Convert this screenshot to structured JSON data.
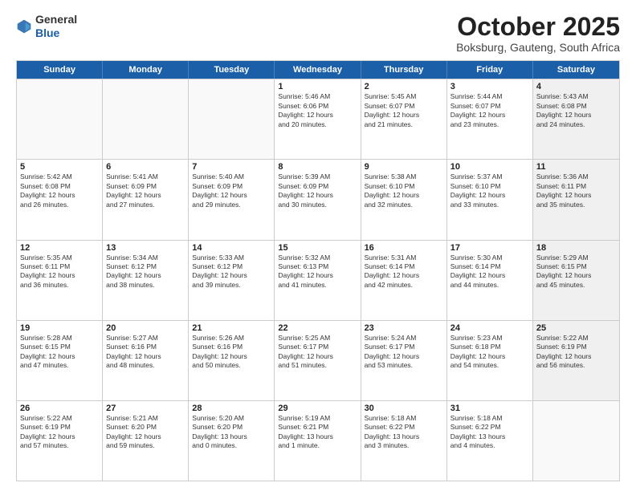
{
  "header": {
    "logo_general": "General",
    "logo_blue": "Blue",
    "month_title": "October 2025",
    "location": "Boksburg, Gauteng, South Africa"
  },
  "days_of_week": [
    "Sunday",
    "Monday",
    "Tuesday",
    "Wednesday",
    "Thursday",
    "Friday",
    "Saturday"
  ],
  "weeks": [
    [
      {
        "day": "",
        "info": "",
        "empty": true
      },
      {
        "day": "",
        "info": "",
        "empty": true
      },
      {
        "day": "",
        "info": "",
        "empty": true
      },
      {
        "day": "1",
        "info": "Sunrise: 5:46 AM\nSunset: 6:06 PM\nDaylight: 12 hours\nand 20 minutes.",
        "empty": false
      },
      {
        "day": "2",
        "info": "Sunrise: 5:45 AM\nSunset: 6:07 PM\nDaylight: 12 hours\nand 21 minutes.",
        "empty": false
      },
      {
        "day": "3",
        "info": "Sunrise: 5:44 AM\nSunset: 6:07 PM\nDaylight: 12 hours\nand 23 minutes.",
        "empty": false
      },
      {
        "day": "4",
        "info": "Sunrise: 5:43 AM\nSunset: 6:08 PM\nDaylight: 12 hours\nand 24 minutes.",
        "empty": false
      }
    ],
    [
      {
        "day": "5",
        "info": "Sunrise: 5:42 AM\nSunset: 6:08 PM\nDaylight: 12 hours\nand 26 minutes.",
        "empty": false
      },
      {
        "day": "6",
        "info": "Sunrise: 5:41 AM\nSunset: 6:09 PM\nDaylight: 12 hours\nand 27 minutes.",
        "empty": false
      },
      {
        "day": "7",
        "info": "Sunrise: 5:40 AM\nSunset: 6:09 PM\nDaylight: 12 hours\nand 29 minutes.",
        "empty": false
      },
      {
        "day": "8",
        "info": "Sunrise: 5:39 AM\nSunset: 6:09 PM\nDaylight: 12 hours\nand 30 minutes.",
        "empty": false
      },
      {
        "day": "9",
        "info": "Sunrise: 5:38 AM\nSunset: 6:10 PM\nDaylight: 12 hours\nand 32 minutes.",
        "empty": false
      },
      {
        "day": "10",
        "info": "Sunrise: 5:37 AM\nSunset: 6:10 PM\nDaylight: 12 hours\nand 33 minutes.",
        "empty": false
      },
      {
        "day": "11",
        "info": "Sunrise: 5:36 AM\nSunset: 6:11 PM\nDaylight: 12 hours\nand 35 minutes.",
        "empty": false
      }
    ],
    [
      {
        "day": "12",
        "info": "Sunrise: 5:35 AM\nSunset: 6:11 PM\nDaylight: 12 hours\nand 36 minutes.",
        "empty": false
      },
      {
        "day": "13",
        "info": "Sunrise: 5:34 AM\nSunset: 6:12 PM\nDaylight: 12 hours\nand 38 minutes.",
        "empty": false
      },
      {
        "day": "14",
        "info": "Sunrise: 5:33 AM\nSunset: 6:12 PM\nDaylight: 12 hours\nand 39 minutes.",
        "empty": false
      },
      {
        "day": "15",
        "info": "Sunrise: 5:32 AM\nSunset: 6:13 PM\nDaylight: 12 hours\nand 41 minutes.",
        "empty": false
      },
      {
        "day": "16",
        "info": "Sunrise: 5:31 AM\nSunset: 6:14 PM\nDaylight: 12 hours\nand 42 minutes.",
        "empty": false
      },
      {
        "day": "17",
        "info": "Sunrise: 5:30 AM\nSunset: 6:14 PM\nDaylight: 12 hours\nand 44 minutes.",
        "empty": false
      },
      {
        "day": "18",
        "info": "Sunrise: 5:29 AM\nSunset: 6:15 PM\nDaylight: 12 hours\nand 45 minutes.",
        "empty": false
      }
    ],
    [
      {
        "day": "19",
        "info": "Sunrise: 5:28 AM\nSunset: 6:15 PM\nDaylight: 12 hours\nand 47 minutes.",
        "empty": false
      },
      {
        "day": "20",
        "info": "Sunrise: 5:27 AM\nSunset: 6:16 PM\nDaylight: 12 hours\nand 48 minutes.",
        "empty": false
      },
      {
        "day": "21",
        "info": "Sunrise: 5:26 AM\nSunset: 6:16 PM\nDaylight: 12 hours\nand 50 minutes.",
        "empty": false
      },
      {
        "day": "22",
        "info": "Sunrise: 5:25 AM\nSunset: 6:17 PM\nDaylight: 12 hours\nand 51 minutes.",
        "empty": false
      },
      {
        "day": "23",
        "info": "Sunrise: 5:24 AM\nSunset: 6:17 PM\nDaylight: 12 hours\nand 53 minutes.",
        "empty": false
      },
      {
        "day": "24",
        "info": "Sunrise: 5:23 AM\nSunset: 6:18 PM\nDaylight: 12 hours\nand 54 minutes.",
        "empty": false
      },
      {
        "day": "25",
        "info": "Sunrise: 5:22 AM\nSunset: 6:19 PM\nDaylight: 12 hours\nand 56 minutes.",
        "empty": false
      }
    ],
    [
      {
        "day": "26",
        "info": "Sunrise: 5:22 AM\nSunset: 6:19 PM\nDaylight: 12 hours\nand 57 minutes.",
        "empty": false
      },
      {
        "day": "27",
        "info": "Sunrise: 5:21 AM\nSunset: 6:20 PM\nDaylight: 12 hours\nand 59 minutes.",
        "empty": false
      },
      {
        "day": "28",
        "info": "Sunrise: 5:20 AM\nSunset: 6:20 PM\nDaylight: 13 hours\nand 0 minutes.",
        "empty": false
      },
      {
        "day": "29",
        "info": "Sunrise: 5:19 AM\nSunset: 6:21 PM\nDaylight: 13 hours\nand 1 minute.",
        "empty": false
      },
      {
        "day": "30",
        "info": "Sunrise: 5:18 AM\nSunset: 6:22 PM\nDaylight: 13 hours\nand 3 minutes.",
        "empty": false
      },
      {
        "day": "31",
        "info": "Sunrise: 5:18 AM\nSunset: 6:22 PM\nDaylight: 13 hours\nand 4 minutes.",
        "empty": false
      },
      {
        "day": "",
        "info": "",
        "empty": true
      }
    ]
  ]
}
